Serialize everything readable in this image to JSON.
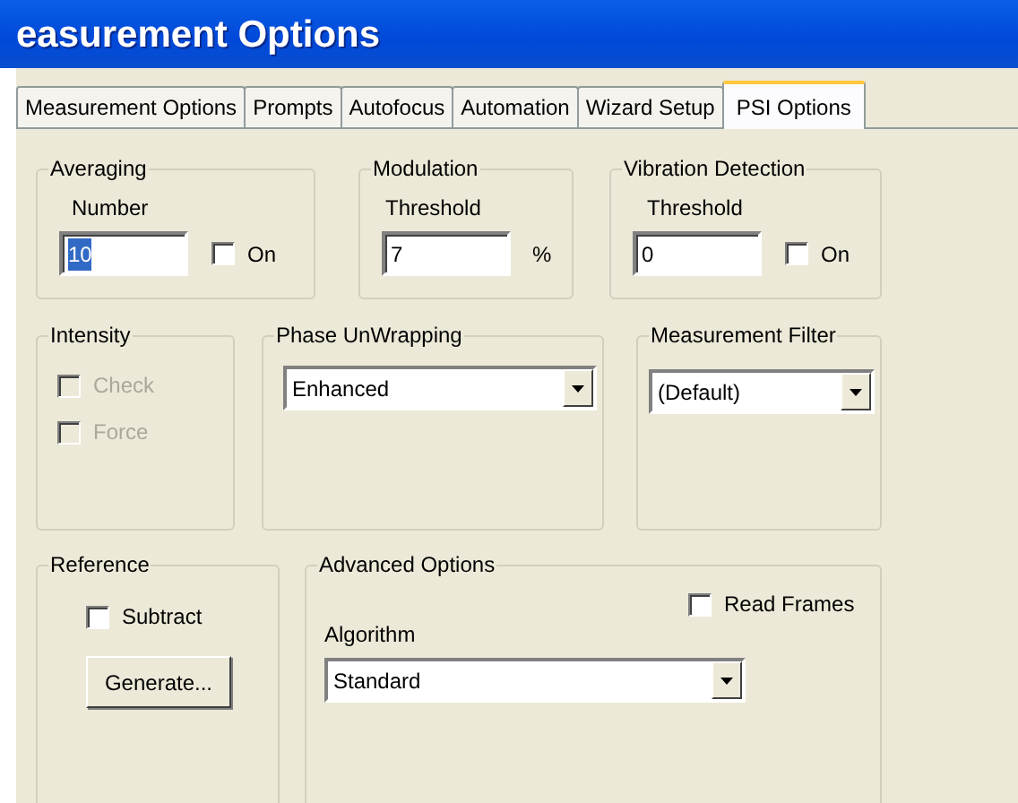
{
  "window": {
    "title": "easurement Options"
  },
  "tabs": [
    {
      "label": "Measurement Options",
      "selected": false
    },
    {
      "label": "Prompts",
      "selected": false
    },
    {
      "label": "Autofocus",
      "selected": false
    },
    {
      "label": "Automation",
      "selected": false
    },
    {
      "label": "Wizard Setup",
      "selected": false
    },
    {
      "label": "PSI Options",
      "selected": true
    }
  ],
  "averaging": {
    "title": "Averaging",
    "label": "Number",
    "value": "10",
    "value_selected": true,
    "checkbox": {
      "label": "On",
      "checked": false
    }
  },
  "modulation": {
    "title": "Modulation",
    "label": "Threshold",
    "value": "7",
    "unit": "%"
  },
  "vibration_detection": {
    "title": "Vibration Detection",
    "label": "Threshold",
    "value": "0",
    "checkbox": {
      "label": "On",
      "checked": false
    }
  },
  "intensity": {
    "title": "Intensity",
    "options": [
      {
        "label": "Check",
        "checked": false,
        "disabled": true
      },
      {
        "label": "Force",
        "checked": false,
        "disabled": true
      }
    ]
  },
  "phase_unwrapping": {
    "title": "Phase UnWrapping",
    "value": "Enhanced"
  },
  "measurement_filter": {
    "title": "Measurement Filter",
    "value": "(Default)"
  },
  "reference": {
    "title": "Reference",
    "checkbox": {
      "label": "Subtract",
      "checked": false
    },
    "button": "Generate..."
  },
  "advanced_options": {
    "title": "Advanced Options",
    "checkbox": {
      "label": "Read Frames",
      "checked": false
    },
    "label": "Algorithm",
    "value": "Standard"
  }
}
